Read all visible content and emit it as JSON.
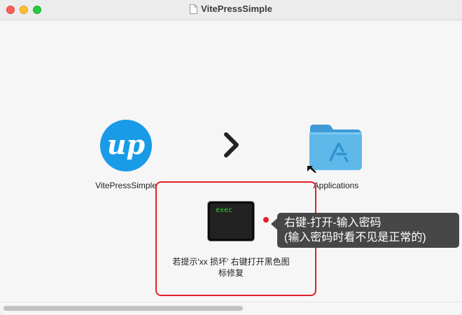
{
  "window": {
    "title": "VitePressSimple",
    "controls": [
      "close",
      "minimize",
      "zoom"
    ]
  },
  "items": {
    "app": {
      "label": "VitePressSimple",
      "logo_text": "up",
      "color": "#1a9be8"
    },
    "arrow": {
      "icon": "chevron-right-icon"
    },
    "applications": {
      "label": "Applications",
      "color": "#5fb8ea"
    },
    "exec": {
      "icon_text": "exec",
      "label": "若提示'xx 损坏' 右键打开黑色图标修复"
    }
  },
  "tooltip": {
    "line1": "右键-打开-输入密码",
    "line2": "(输入密码时看不见是正常的)"
  },
  "colors": {
    "highlight": "#e3202a",
    "tooltip_bg": "#474747"
  }
}
